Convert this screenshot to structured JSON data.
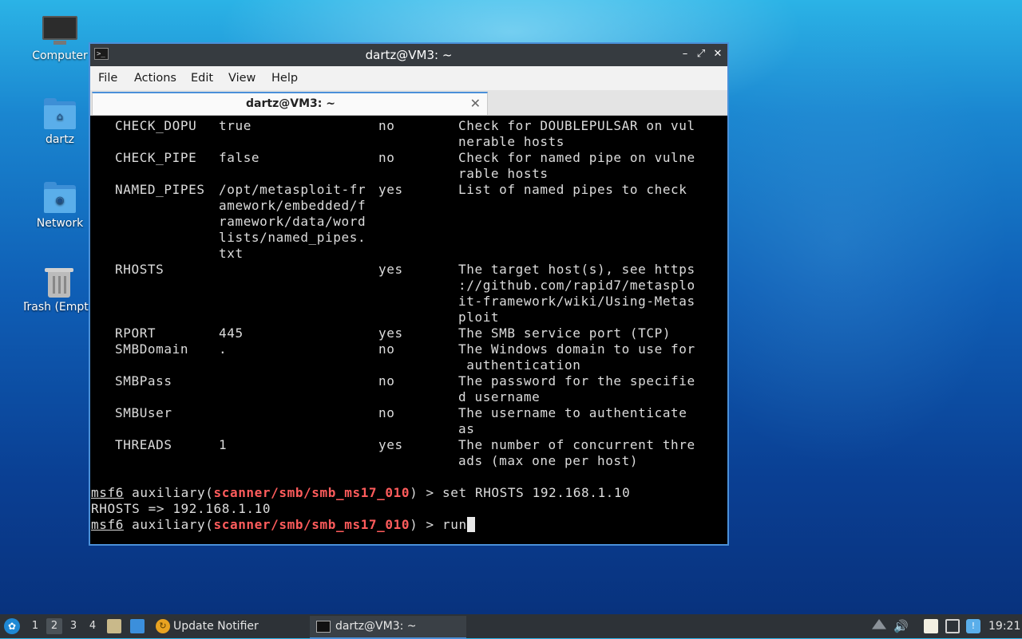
{
  "desktop": {
    "icons": [
      {
        "label": "Computer",
        "icon": "computer-icon"
      },
      {
        "label": "dartz",
        "icon": "home-folder-icon"
      },
      {
        "label": "Network",
        "icon": "network-folder-icon"
      },
      {
        "label": "Trash (Empty)",
        "icon": "trash-icon"
      }
    ]
  },
  "window": {
    "title": "dartz@VM3: ~",
    "buttons": {
      "minimize": "–",
      "maximize": "⤢",
      "close": "✕"
    },
    "menu": [
      "File",
      "Actions",
      "Edit",
      "View",
      "Help"
    ],
    "tab": {
      "label": "dartz@VM3: ~",
      "close": "✕"
    }
  },
  "terminal": {
    "options": [
      {
        "name": "CHECK_DOPU",
        "setting": [
          "true"
        ],
        "required": "no",
        "description": [
          "Check for DOUBLEPULSAR on vul",
          "nerable hosts"
        ]
      },
      {
        "name": "CHECK_PIPE",
        "setting": [
          "false"
        ],
        "required": "no",
        "description": [
          "Check for named pipe on vulne",
          "rable hosts"
        ]
      },
      {
        "name": "NAMED_PIPES",
        "setting": [
          "/opt/metasploit-fr",
          "amework/embedded/f",
          "ramework/data/word",
          "lists/named_pipes.",
          "txt"
        ],
        "required": "yes",
        "description": [
          "List of named pipes to check"
        ]
      },
      {
        "name": "RHOSTS",
        "setting": [],
        "required": "yes",
        "description": [
          "The target host(s), see https",
          "://github.com/rapid7/metasplo",
          "it-framework/wiki/Using-Metas",
          "ploit"
        ]
      },
      {
        "name": "RPORT",
        "setting": [
          "445"
        ],
        "required": "yes",
        "description": [
          "The SMB service port (TCP)"
        ]
      },
      {
        "name": "SMBDomain",
        "setting": [
          "."
        ],
        "required": "no",
        "description": [
          "The Windows domain to use for",
          " authentication"
        ]
      },
      {
        "name": "SMBPass",
        "setting": [],
        "required": "no",
        "description": [
          "The password for the specifie",
          "d username"
        ]
      },
      {
        "name": "SMBUser",
        "setting": [],
        "required": "no",
        "description": [
          "The username to authenticate",
          "as"
        ]
      },
      {
        "name": "THREADS",
        "setting": [
          "1"
        ],
        "required": "yes",
        "description": [
          "The number of concurrent thre",
          "ads (max one per host)"
        ]
      }
    ],
    "prompt_user": "msf6",
    "prompt_mid": " auxiliary(",
    "module": "scanner/smb/smb_ms17_010",
    "prompt_end": ") > ",
    "cmd1": "set RHOSTS 192.168.1.10",
    "output1": "RHOSTS => 192.168.1.10",
    "cmd2": "run"
  },
  "taskbar": {
    "workspaces": [
      "1",
      "2",
      "3",
      "4"
    ],
    "active_workspace": "2",
    "tasks": [
      {
        "label": "Update Notifier"
      },
      {
        "label": "dartz@VM3: ~"
      }
    ],
    "clock": "19:21"
  }
}
